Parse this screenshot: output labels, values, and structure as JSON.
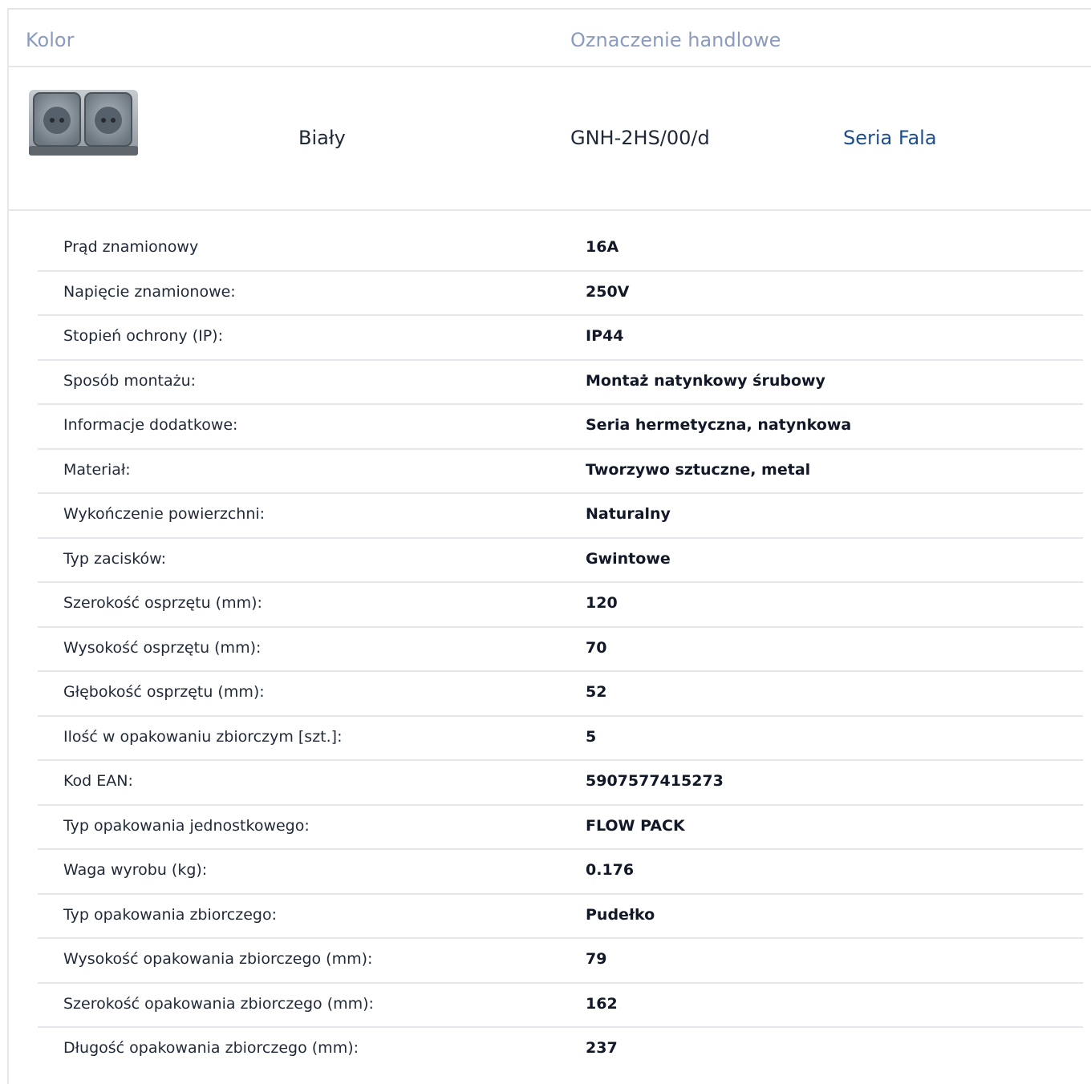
{
  "header": {
    "color_label": "Kolor",
    "trade_label": "Oznaczenie handlowe"
  },
  "product": {
    "image_name": "double-socket-icon",
    "color": "Biały",
    "code": "GNH-2HS/00/d",
    "series": "Seria Fala",
    "series_color": "#1d4e89"
  },
  "specs": [
    {
      "label": "Prąd znamionowy",
      "value": "16A"
    },
    {
      "label": "Napięcie znamionowe:",
      "value": "250V"
    },
    {
      "label": "Stopień ochrony (IP):",
      "value": "IP44"
    },
    {
      "label": "Sposób montażu:",
      "value": "Montaż natynkowy śrubowy"
    },
    {
      "label": "Informacje dodatkowe:",
      "value": "Seria hermetyczna, natynkowa"
    },
    {
      "label": "Materiał:",
      "value": "Tworzywo sztuczne, metal"
    },
    {
      "label": "Wykończenie powierzchni:",
      "value": "Naturalny"
    },
    {
      "label": "Typ zacisków:",
      "value": "Gwintowe"
    },
    {
      "label": "Szerokość osprzętu (mm):",
      "value": "120"
    },
    {
      "label": "Wysokość osprzętu (mm):",
      "value": "70"
    },
    {
      "label": "Głębokość osprzętu (mm):",
      "value": "52"
    },
    {
      "label": "Ilość w opakowaniu zbiorczym [szt.]:",
      "value": "5"
    },
    {
      "label": "Kod EAN:",
      "value": "5907577415273"
    },
    {
      "label": "Typ opakowania jednostkowego:",
      "value": "FLOW PACK"
    },
    {
      "label": "Waga wyrobu (kg):",
      "value": "0.176"
    },
    {
      "label": "Typ opakowania zbiorczego:",
      "value": "Pudełko"
    },
    {
      "label": "Wysokość opakowania zbiorczego (mm):",
      "value": "79"
    },
    {
      "label": "Szerokość opakowania zbiorczego (mm):",
      "value": "162"
    },
    {
      "label": "Długość opakowania zbiorczego (mm):",
      "value": "237"
    }
  ]
}
